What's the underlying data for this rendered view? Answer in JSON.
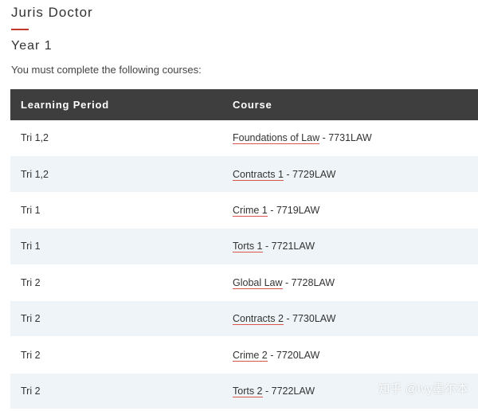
{
  "page": {
    "title": "Juris Doctor",
    "year_heading": "Year 1",
    "intro": "You must complete the following courses:"
  },
  "table": {
    "headers": {
      "period": "Learning Period",
      "course": "Course"
    },
    "rows": [
      {
        "period": "Tri 1,2",
        "course_name": "Foundations of Law",
        "course_code": " - 7731LAW"
      },
      {
        "period": "Tri 1,2",
        "course_name": "Contracts 1",
        "course_code": " - 7729LAW"
      },
      {
        "period": "Tri 1",
        "course_name": "Crime 1",
        "course_code": " - 7719LAW"
      },
      {
        "period": "Tri 1",
        "course_name": "Torts 1",
        "course_code": " - 7721LAW"
      },
      {
        "period": "Tri 2",
        "course_name": "Global Law",
        "course_code": " - 7728LAW"
      },
      {
        "period": "Tri 2",
        "course_name": "Contracts 2",
        "course_code": " - 7730LAW"
      },
      {
        "period": "Tri 2",
        "course_name": "Crime 2",
        "course_code": " - 7720LAW"
      },
      {
        "period": "Tri 2",
        "course_name": "Torts 2",
        "course_code": " - 7722LAW"
      }
    ]
  },
  "watermark": "知乎 @Ivy墨尔本",
  "colors": {
    "header_bg": "#3e3e3e",
    "accent": "#c0392b",
    "row_alt": "#eef4f8"
  }
}
